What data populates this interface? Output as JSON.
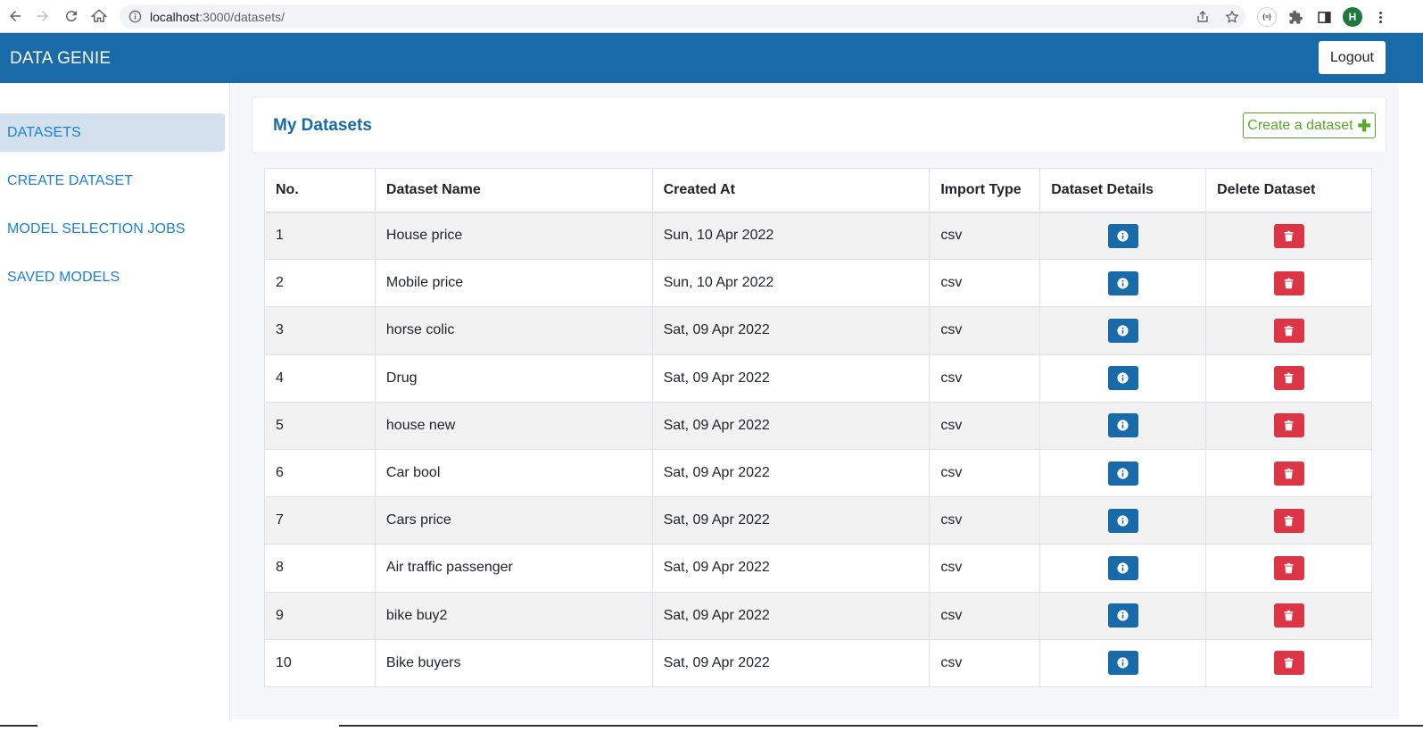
{
  "browser": {
    "url_host": "localhost",
    "url_path": ":3000/datasets/",
    "profile_initial": "H",
    "extension_badge": "{≡}"
  },
  "header": {
    "brand": "DATA GENIE",
    "logout_label": "Logout"
  },
  "sidebar": {
    "items": [
      {
        "label": "DATASETS",
        "active": true
      },
      {
        "label": "CREATE DATASET",
        "active": false
      },
      {
        "label": "MODEL SELECTION JOBS",
        "active": false
      },
      {
        "label": "SAVED MODELS",
        "active": false
      }
    ]
  },
  "main": {
    "title": "My Datasets",
    "create_label": "Create a dataset",
    "create_icon": "plus-icon",
    "table": {
      "headers": [
        "No.",
        "Dataset Name",
        "Created At",
        "Import Type",
        "Dataset Details",
        "Delete Dataset"
      ],
      "rows": [
        {
          "no": "1",
          "name": "House price",
          "created": "Sun, 10 Apr 2022",
          "type": "csv"
        },
        {
          "no": "2",
          "name": "Mobile price",
          "created": "Sun, 10 Apr 2022",
          "type": "csv"
        },
        {
          "no": "3",
          "name": "horse colic",
          "created": "Sat, 09 Apr 2022",
          "type": "csv"
        },
        {
          "no": "4",
          "name": "Drug",
          "created": "Sat, 09 Apr 2022",
          "type": "csv"
        },
        {
          "no": "5",
          "name": "house new",
          "created": "Sat, 09 Apr 2022",
          "type": "csv"
        },
        {
          "no": "6",
          "name": "Car bool",
          "created": "Sat, 09 Apr 2022",
          "type": "csv"
        },
        {
          "no": "7",
          "name": "Cars price",
          "created": "Sat, 09 Apr 2022",
          "type": "csv"
        },
        {
          "no": "8",
          "name": "Air traffic passenger",
          "created": "Sat, 09 Apr 2022",
          "type": "csv"
        },
        {
          "no": "9",
          "name": "bike buy2",
          "created": "Sat, 09 Apr 2022",
          "type": "csv"
        },
        {
          "no": "10",
          "name": "Bike buyers",
          "created": "Sat, 09 Apr 2022",
          "type": "csv"
        }
      ]
    }
  },
  "colors": {
    "brand_blue": "#196aa9",
    "link_blue": "#1c7fd4",
    "success_green": "#58a829",
    "danger_red": "#dc3545"
  }
}
